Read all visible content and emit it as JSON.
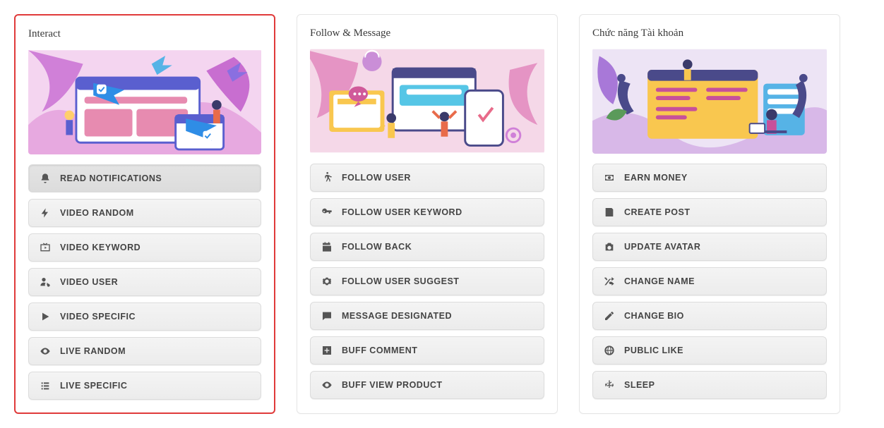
{
  "cards": [
    {
      "title": "Interact",
      "highlighted": true,
      "illustration": "interact",
      "actions": [
        {
          "icon": "bell-icon",
          "label": "READ NOTIFICATIONS",
          "active": true
        },
        {
          "icon": "bolt-icon",
          "label": "VIDEO RANDOM",
          "active": false
        },
        {
          "icon": "tv-icon",
          "label": "VIDEO KEYWORD",
          "active": false
        },
        {
          "icon": "user-gear-icon",
          "label": "VIDEO USER",
          "active": false
        },
        {
          "icon": "play-icon",
          "label": "VIDEO SPECIFIC",
          "active": false
        },
        {
          "icon": "eye-icon",
          "label": "LIVE RANDOM",
          "active": false
        },
        {
          "icon": "list-icon",
          "label": "LIVE SPECIFIC",
          "active": false
        }
      ]
    },
    {
      "title": "Follow & Message",
      "highlighted": false,
      "illustration": "follow",
      "actions": [
        {
          "icon": "walk-icon",
          "label": "FOLLOW USER",
          "active": false
        },
        {
          "icon": "key-icon",
          "label": "FOLLOW USER KEYWORD",
          "active": false
        },
        {
          "icon": "calendar-icon",
          "label": "FOLLOW BACK",
          "active": false
        },
        {
          "icon": "gear-icon",
          "label": "FOLLOW USER SUGGEST",
          "active": false
        },
        {
          "icon": "message-icon",
          "label": "MESSAGE DESIGNATED",
          "active": false
        },
        {
          "icon": "plus-square-icon",
          "label": "BUFF COMMENT",
          "active": false
        },
        {
          "icon": "eye-icon",
          "label": "BUFF VIEW PRODUCT",
          "active": false
        }
      ]
    },
    {
      "title": "Chức năng Tài khoản",
      "highlighted": false,
      "illustration": "account",
      "actions": [
        {
          "icon": "money-icon",
          "label": "EARN MONEY",
          "active": false
        },
        {
          "icon": "post-icon",
          "label": "CREATE POST",
          "active": false
        },
        {
          "icon": "camera-icon",
          "label": "UPDATE AVATAR",
          "active": false
        },
        {
          "icon": "shuffle-icon",
          "label": "CHANGE NAME",
          "active": false
        },
        {
          "icon": "pencil-icon",
          "label": "CHANGE BIO",
          "active": false
        },
        {
          "icon": "globe-icon",
          "label": "PUBLIC LIKE",
          "active": false
        },
        {
          "icon": "snowflake-icon",
          "label": "SLEEP",
          "active": false
        }
      ]
    }
  ]
}
